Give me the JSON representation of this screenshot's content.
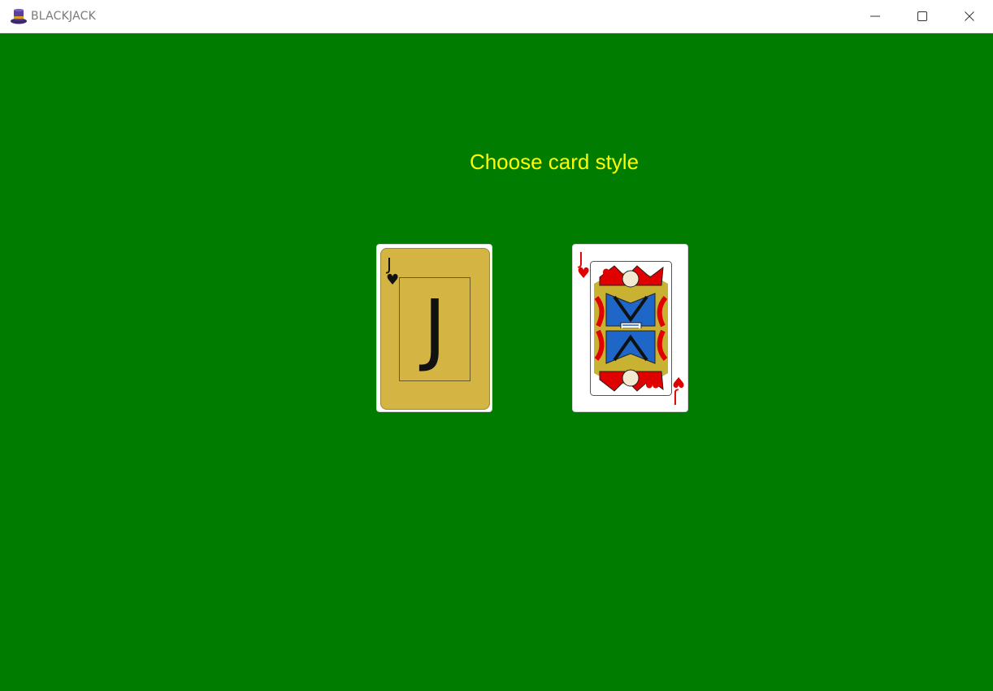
{
  "window": {
    "title": "BLACKJACK",
    "icon": "top-hat-icon",
    "controls": [
      "minimize-icon",
      "maximize-icon",
      "close-icon"
    ]
  },
  "screen": {
    "heading": "Choose card style",
    "background_color": "#007d00",
    "heading_color": "#ffff00"
  },
  "card_styles": [
    {
      "id": "simple",
      "rank": "J",
      "suit_symbol": "♥",
      "face_color": "#d4b442",
      "ink_color": "#111111"
    },
    {
      "id": "classic",
      "rank": "J",
      "suit_symbol": "♥",
      "ink_color": "#e00000"
    }
  ]
}
